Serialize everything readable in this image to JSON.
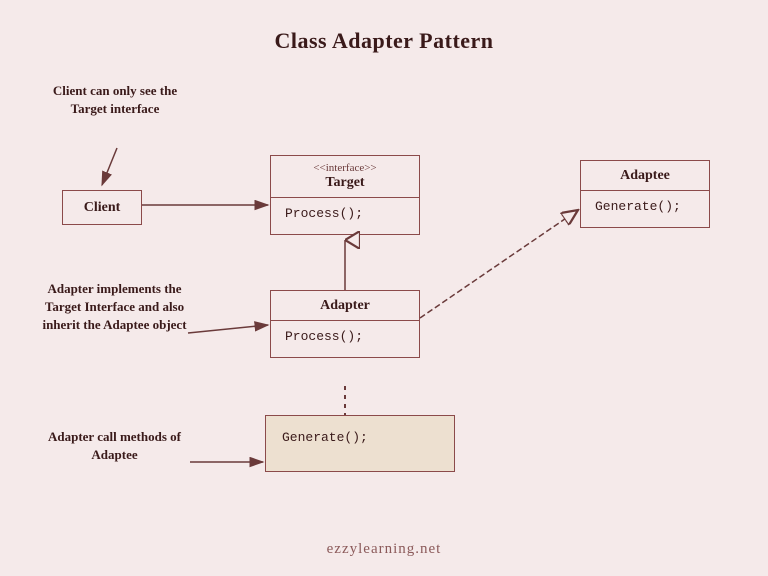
{
  "title": "Class Adapter Pattern",
  "footer": "ezzylearning.net",
  "boxes": {
    "client": {
      "label": "Client"
    },
    "target": {
      "stereotype": "<<interface>>",
      "classname": "Target",
      "method": "Process();"
    },
    "adaptee": {
      "classname": "Adaptee",
      "method": "Generate();"
    },
    "adapter": {
      "classname": "Adapter",
      "method": "Process();"
    },
    "generate": {
      "method": "Generate();"
    }
  },
  "annotations": {
    "client": "Client can only see the Target interface",
    "adapter": "Adapter implements the Target Interface and also inherit the Adaptee object",
    "adaptee": "Adapter call methods of Adaptee"
  }
}
